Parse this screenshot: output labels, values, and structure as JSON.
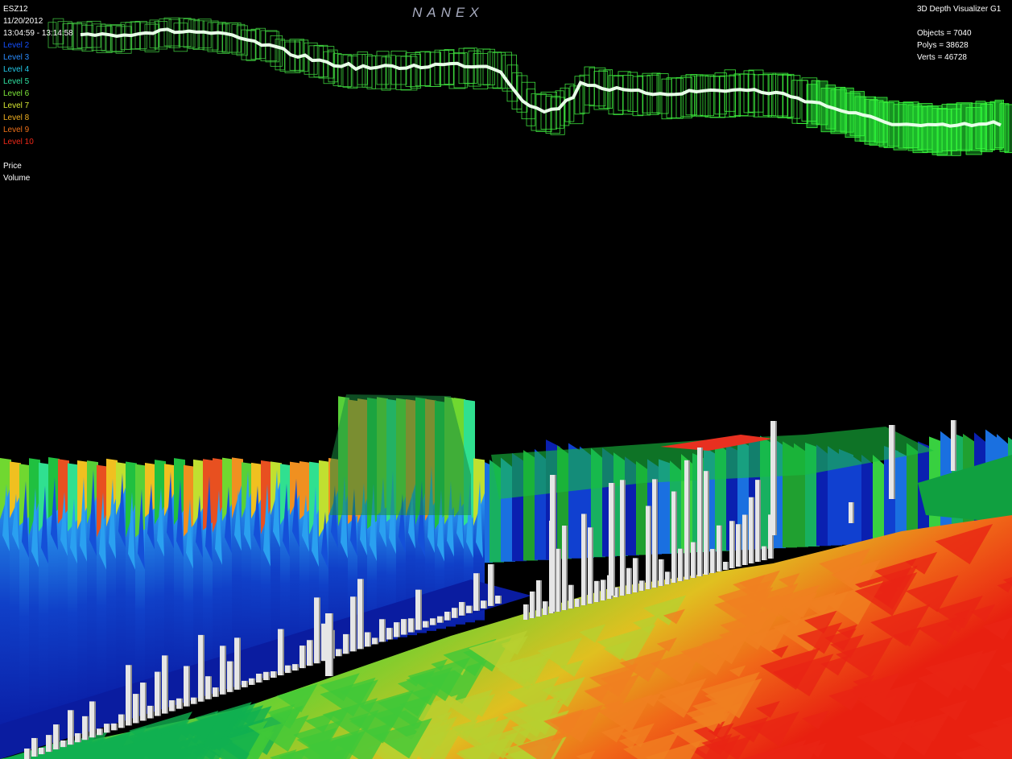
{
  "window": {
    "app_title": "3D Depth Visualizer G1",
    "brand": "NANEX"
  },
  "info": {
    "symbol": "ESZ12",
    "date": "11/20/2012",
    "time_range": "13:04:59 - 13:14:58",
    "objects_text": "Objects = 7040",
    "polys_text": "Polys = 38628",
    "verts_text": "Verts = 46728"
  },
  "legend": {
    "levels": [
      {
        "label": "Level 2",
        "color": "#1450ff"
      },
      {
        "label": "Level 3",
        "color": "#2a8cff"
      },
      {
        "label": "Level 4",
        "color": "#22c8e8"
      },
      {
        "label": "Level 5",
        "color": "#2fe0a0"
      },
      {
        "label": "Level 6",
        "color": "#7ee83a"
      },
      {
        "label": "Level 7",
        "color": "#d8e832"
      },
      {
        "label": "Level 8",
        "color": "#f0b020"
      },
      {
        "label": "Level 9",
        "color": "#f07018"
      },
      {
        "label": "Level 10",
        "color": "#f02818"
      }
    ],
    "price_label": "Price",
    "volume_label": "Volume"
  }
}
